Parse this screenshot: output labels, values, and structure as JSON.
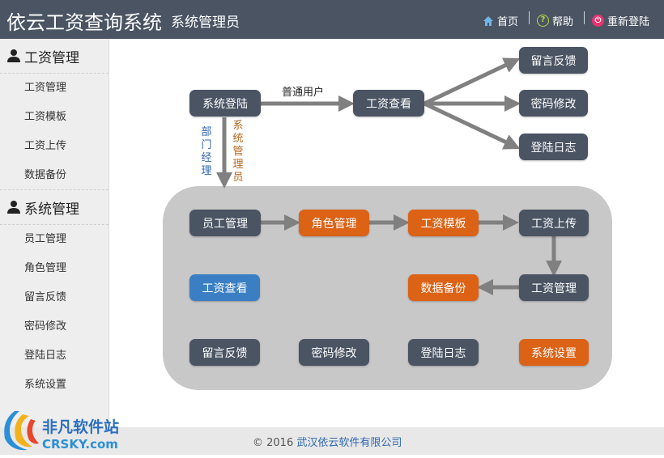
{
  "header": {
    "title": "依云工资查询系统",
    "role": "系统管理员",
    "nav": {
      "home": "首页",
      "help": "帮助",
      "relogin": "重新登陆"
    }
  },
  "sidebar": {
    "groups": [
      {
        "label": "工资管理",
        "items": [
          "工资管理",
          "工资模板",
          "工资上传",
          "数据备份"
        ]
      },
      {
        "label": "系统管理",
        "items": [
          "员工管理",
          "角色管理",
          "留言反馈",
          "密码修改",
          "登陆日志",
          "系统设置"
        ]
      }
    ]
  },
  "flow": {
    "login": "系统登陆",
    "view_top": "工资查看",
    "feedback_top": "留言反馈",
    "password_top": "密码修改",
    "log_top": "登陆日志",
    "edge_normal": "普通用户",
    "edge_dept": "部门经理",
    "edge_admin": "系统管理员",
    "employee_mgmt": "员工管理",
    "role_mgmt": "角色管理",
    "salary_template": "工资模板",
    "salary_upload": "工资上传",
    "salary_view": "工资查看",
    "data_backup": "数据备份",
    "salary_mgmt": "工资管理",
    "feedback": "留言反馈",
    "password": "密码修改",
    "login_log": "登陆日志",
    "system_settings": "系统设置"
  },
  "footer": {
    "copyright": "© 2016",
    "company": "武汉依云软件有限公司"
  },
  "watermark": {
    "brand": "非凡软件站",
    "site": "CRSKY.com"
  },
  "colors": {
    "header": "#4a5463",
    "orange": "#dc6216",
    "blue": "#3a7fc4",
    "panel": "#c8c8c8"
  }
}
